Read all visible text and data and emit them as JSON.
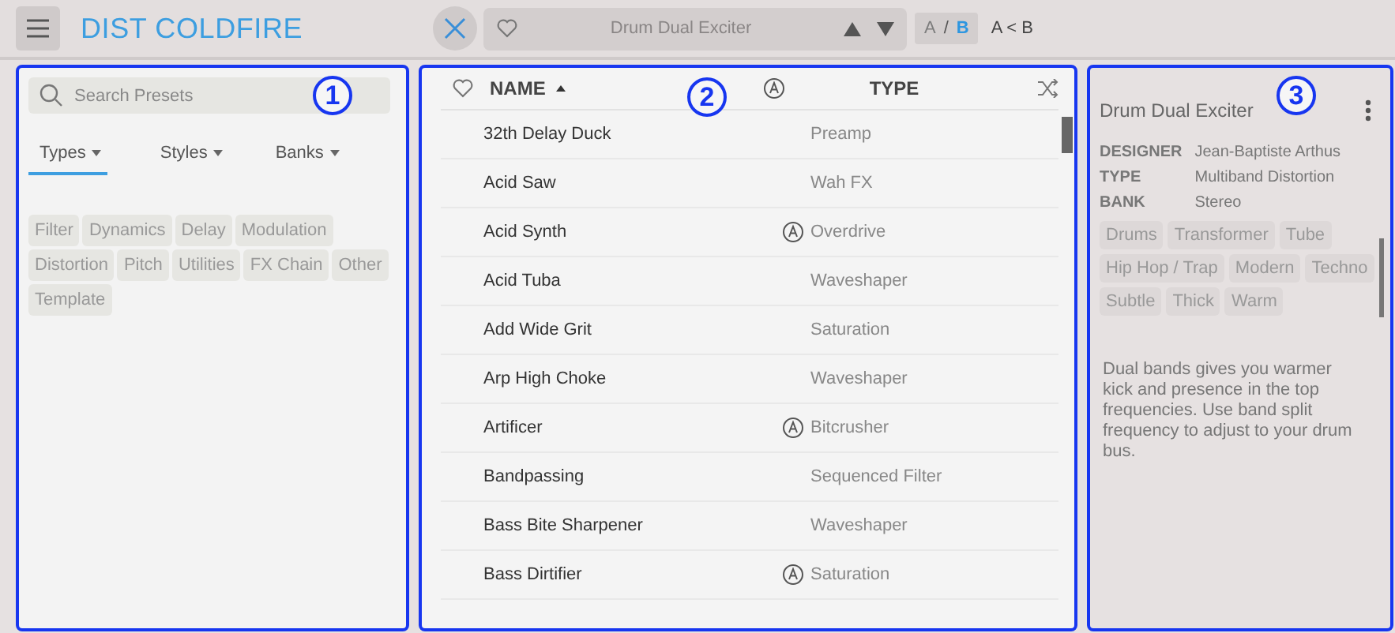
{
  "toolbar": {
    "title": "DIST COLDFIRE",
    "preset_name": "Drum Dual Exciter",
    "ab": [
      {
        "label": "A",
        "selected": false
      },
      {
        "label": "B",
        "selected": true
      }
    ],
    "ab_separator": "/",
    "compare": "A < B"
  },
  "browser": {
    "callout": "1",
    "search": {
      "placeholder": "Search Presets"
    },
    "filter_tabs": [
      {
        "label": "Types",
        "selected": true
      },
      {
        "label": "Styles",
        "selected": false
      },
      {
        "label": "Banks",
        "selected": false
      }
    ],
    "tags": [
      "Filter",
      "Dynamics",
      "Delay",
      "Modulation",
      "Distortion",
      "Pitch",
      "Utilities",
      "FX Chain",
      "Other",
      "Template"
    ]
  },
  "list": {
    "callout": "2",
    "columns": [
      "NAME",
      "TYPE"
    ],
    "rows": [
      {
        "name": "32th Delay Duck",
        "factory": false,
        "type": "Preamp"
      },
      {
        "name": "Acid Saw",
        "factory": false,
        "type": "Wah FX"
      },
      {
        "name": "Acid Synth",
        "factory": true,
        "type": "Overdrive"
      },
      {
        "name": "Acid Tuba",
        "factory": false,
        "type": "Waveshaper"
      },
      {
        "name": "Add Wide Grit",
        "factory": false,
        "type": "Saturation"
      },
      {
        "name": "Arp High Choke",
        "factory": false,
        "type": "Waveshaper"
      },
      {
        "name": "Artificer",
        "factory": true,
        "type": "Bitcrusher"
      },
      {
        "name": "Bandpassing",
        "factory": false,
        "type": "Sequenced Filter"
      },
      {
        "name": "Bass Bite Sharpener",
        "factory": false,
        "type": "Waveshaper"
      },
      {
        "name": "Bass Dirtifier",
        "factory": true,
        "type": "Saturation"
      }
    ]
  },
  "info": {
    "callout": "3",
    "title": "Drum Dual Exciter",
    "fields": [
      {
        "label": "DESIGNER",
        "value": "Jean-Baptiste Arthus"
      },
      {
        "label": "TYPE",
        "value": "Multiband Distortion"
      },
      {
        "label": "BANK",
        "value": "Stereo"
      }
    ],
    "tags": [
      "Drums",
      "Transformer",
      "Tube",
      "Hip Hop / Trap",
      "Modern",
      "Techno",
      "Subtle",
      "Thick",
      "Warm"
    ],
    "description": "Dual bands gives you warmer kick and presence in the top frequencies. Use band split frequency to adjust to your drum bus."
  }
}
